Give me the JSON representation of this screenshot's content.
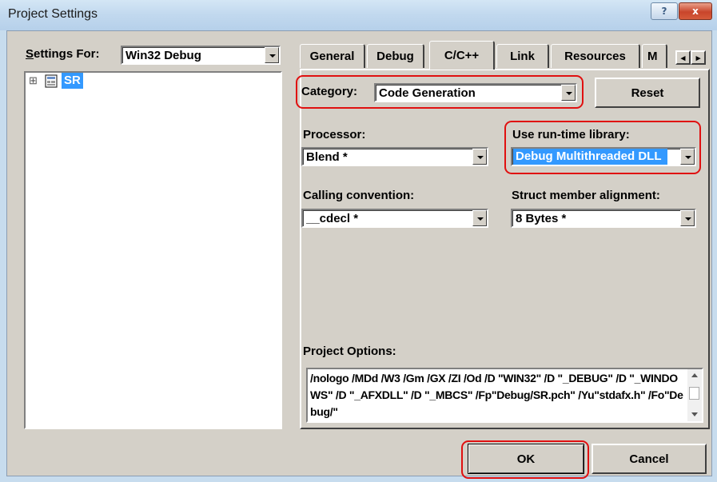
{
  "window": {
    "title": "Project Settings",
    "help_label": "?",
    "close_label": "x"
  },
  "left": {
    "settings_for_label": "Settings For:",
    "settings_for_value": "Win32 Debug",
    "tree_items": [
      {
        "label": "SR",
        "expand_glyph": "⊞",
        "icon": "project-icon"
      }
    ]
  },
  "tabs": [
    {
      "label": "General",
      "active": false
    },
    {
      "label": "Debug",
      "active": false
    },
    {
      "label": "C/C++",
      "active": true
    },
    {
      "label": "Link",
      "active": false
    },
    {
      "label": "Resources",
      "active": false
    },
    {
      "label": "M",
      "active": false
    }
  ],
  "tab_scroll": {
    "left": "◂",
    "right": "▸"
  },
  "category": {
    "label": "Category:",
    "value": "Code Generation"
  },
  "reset_label": "Reset",
  "processor": {
    "label": "Processor:",
    "value": "Blend *"
  },
  "runtime": {
    "label": "Use run-time library:",
    "value": "Debug Multithreaded DLL"
  },
  "calling": {
    "label": "Calling convention:",
    "value": "__cdecl *"
  },
  "struct_align": {
    "label": "Struct member alignment:",
    "value": "8 Bytes *"
  },
  "project_options": {
    "label": "Project Options:",
    "text": "/nologo /MDd /W3 /Gm /GX /ZI /Od /D \"WIN32\" /D \"_DEBUG\" /D \"_WINDOWS\" /D \"_AFXDLL\" /D \"_MBCS\" /Fp\"Debug/SR.pch\" /Yu\"stdafx.h\" /Fo\"Debug/\""
  },
  "footer": {
    "ok_label": "OK",
    "cancel_label": "Cancel"
  },
  "colors": {
    "highlight": "#e01010",
    "selection": "#3399ff",
    "face": "#d4d0c8"
  }
}
